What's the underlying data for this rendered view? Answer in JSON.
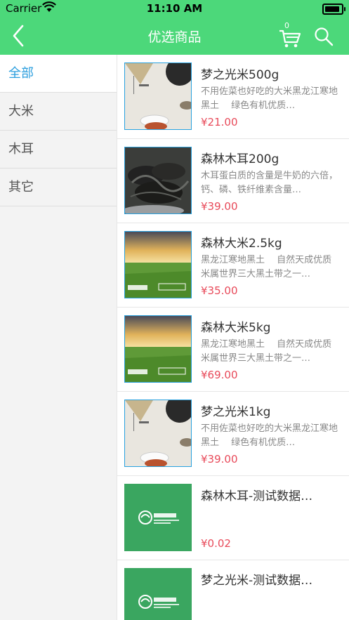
{
  "status": {
    "carrier": "Carrier",
    "time": "11:10 AM"
  },
  "nav": {
    "title": "优选商品",
    "cart_count": "0"
  },
  "categories": [
    {
      "label": "全部",
      "active": true
    },
    {
      "label": "大米",
      "active": false
    },
    {
      "label": "木耳",
      "active": false
    },
    {
      "label": "其它",
      "active": false
    }
  ],
  "products": [
    {
      "name": "梦之光米500g",
      "desc": "不用佐菜也好吃的大米黑龙江寒地黑土　 绿色有机优质…",
      "price": "¥21.00",
      "image": "rice-bowl"
    },
    {
      "name": "森林木耳200g",
      "desc": "木耳蛋白质的含量是牛奶的六倍， 钙、磷、铁纤维素含量…",
      "price": "¥39.00",
      "image": "fungus"
    },
    {
      "name": "森林大米2.5kg",
      "desc": "黑龙江寒地黑土　 自然天成优质米属世界三大黑土带之一…",
      "price": "¥35.00",
      "image": "field"
    },
    {
      "name": "森林大米5kg",
      "desc": "黑龙江寒地黑土　 自然天成优质米属世界三大黑土带之一…",
      "price": "¥69.00",
      "image": "field"
    },
    {
      "name": "梦之光米1kg",
      "desc": "不用佐菜也好吃的大米黑龙江寒地黑土　 绿色有机优质…",
      "price": "¥39.00",
      "image": "rice-bowl"
    },
    {
      "name": "森林木耳-测试数据…",
      "desc": "",
      "price": "¥0.02",
      "image": "logo"
    },
    {
      "name": "梦之光米-测试数据…",
      "desc": "",
      "price": "",
      "image": "logo"
    }
  ]
}
